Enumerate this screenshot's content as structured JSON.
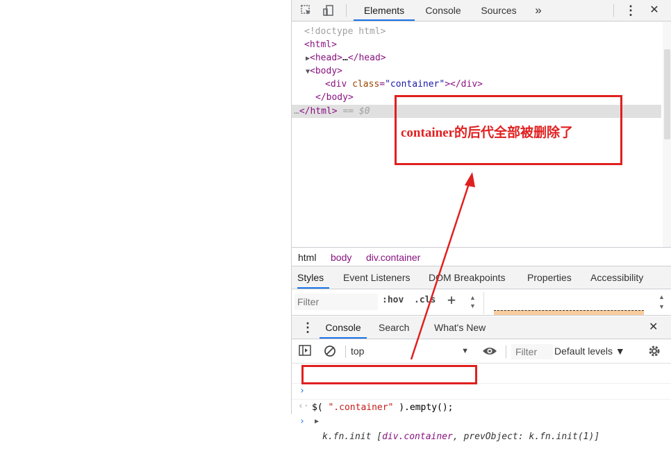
{
  "toolbar": {
    "tabs": [
      "Elements",
      "Console",
      "Sources"
    ],
    "more": "»",
    "menu": "⋮",
    "close": "✕"
  },
  "dom": {
    "doctype": "<!doctype html>",
    "html_open": "<html>",
    "head_open": "<head>",
    "head_ellipsis": "…",
    "head_close": "</head>",
    "body_open": "<body>",
    "div_tag": "div",
    "div_attr": "class",
    "div_value": "\"container\"",
    "div_close": "></div>",
    "body_close": "</body>",
    "html_close": "</html>",
    "dots": "…",
    "selected_suffix": "== $0"
  },
  "breadcrumbs": [
    "html",
    "body",
    "div.container"
  ],
  "styles": {
    "tabs": [
      "Styles",
      "Event Listeners",
      "DOM Breakpoints",
      "Properties",
      "Accessibility"
    ],
    "filter_placeholder": "Filter",
    "hov": ":hov",
    "cls": ".cls",
    "plus": "+"
  },
  "drawer": {
    "tabs": [
      "Console",
      "Search",
      "What's New"
    ],
    "close": "✕"
  },
  "console": {
    "context": "top",
    "filter_placeholder": "Filter",
    "levels": "Default levels ▼",
    "input_prefix": "$( ",
    "input_string": "\".container\"",
    "input_suffix": " ).empty();",
    "result_prefix": "k.fn.init [",
    "result_el": "div.container",
    "result_suffix": ", prevObject: k.fn.init(1)]",
    "prompt": "›"
  },
  "annotation": {
    "text": "container的后代全部被删除了",
    "color": "#e02020"
  },
  "colors": {
    "accent": "#1a73e8",
    "tag": "#881280",
    "attr": "#994500",
    "string": "#1a1aa6"
  }
}
